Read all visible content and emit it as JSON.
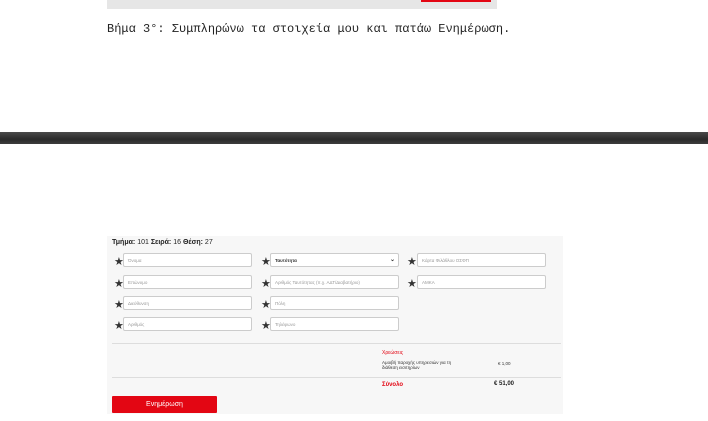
{
  "caption": "Βήμα 3°: Συμπληρώνω τα στοιχεία μου και πατάω Ενημέρωση.",
  "seat_info": {
    "section_label": "Τμήμα:",
    "section_value": "101",
    "row_label": "Σειρά:",
    "row_value": "16",
    "seat_label": "Θέση:",
    "seat_value": "27"
  },
  "form": {
    "required_mark": "★",
    "first_name": "Όνομα",
    "id_type": "Ταυτότητα",
    "fan_card": "Κάρτα Φιλάθλου ΟΣΦΠ",
    "last_name": "Επώνυμο",
    "id_number": "Αριθμός Ταυτότητας (π.χ. ΑΔΤ/Διαβατήριο)",
    "amka": "ΑΜΚΑ",
    "address": "Διεύθυνση",
    "city": "Πόλη",
    "number": "Αριθμός",
    "phone": "Τηλέφωνο"
  },
  "charges": {
    "title": "Χρεώσεις",
    "item_desc": "Αμοιβή παροχής υπηρεσιών για τη διάθεση εισιτηρίων",
    "item_value": "€ 1,00",
    "total_label": "Σύνολο",
    "total_value": "€ 51,00"
  },
  "update_button": "Ενημέρωση",
  "colors": {
    "accent": "#e30613",
    "divider": "#3a3a3a"
  }
}
